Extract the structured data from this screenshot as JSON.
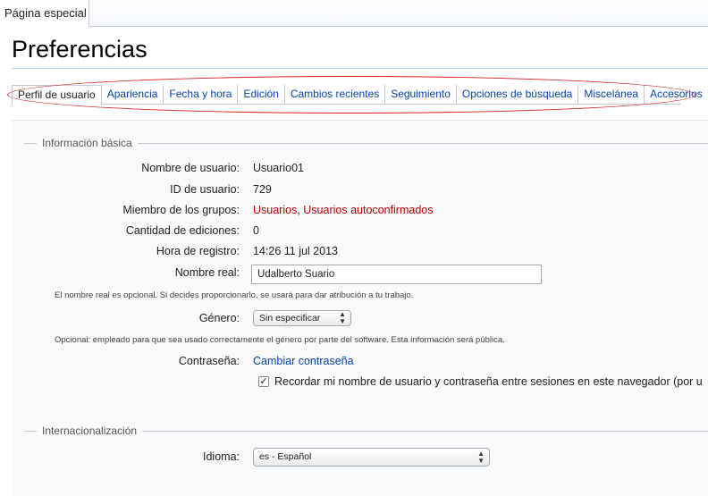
{
  "page_tab": {
    "label": "Página especial"
  },
  "title": "Preferencias",
  "tabs": [
    {
      "label": "Perfil de usuario",
      "active": true
    },
    {
      "label": "Apariencia"
    },
    {
      "label": "Fecha y hora"
    },
    {
      "label": "Edición"
    },
    {
      "label": "Cambios recientes"
    },
    {
      "label": "Seguimiento"
    },
    {
      "label": "Opciones de búsqueda"
    },
    {
      "label": "Miscelánea"
    },
    {
      "label": "Accesorios"
    }
  ],
  "basic": {
    "legend": "Información básica",
    "username_label": "Nombre de usuario:",
    "username": "Usuario01",
    "userid_label": "ID de usuario:",
    "userid": "729",
    "groups_label": "Miembro de los grupos:",
    "group1": "Usuarios",
    "group_sep": ", ",
    "group2": "Usuarios autoconfirmados",
    "edits_label": "Cantidad de ediciones:",
    "edits": "0",
    "registration_label": "Hora de registro:",
    "registration": "14:26 11 jul 2013",
    "realname_label": "Nombre real:",
    "realname": "Udalberto Suario",
    "realname_help": "El nombre real es opcional. Si decides proporcionarlo, se usará para dar atribución a tu trabajo.",
    "gender_label": "Género:",
    "gender": "Sin especificar",
    "gender_help": "Opcional: empleado para que sea usado correctamente el género por parte del software. Esta información será pública.",
    "password_label": "Contraseña:",
    "password_link": "Cambiar contraseña",
    "remember_label": "Recordar mi nombre de usuario y contraseña entre sesiones en este navegador (por u",
    "remember_checked": true
  },
  "i18n": {
    "legend": "Internacionalización",
    "language_label": "Idioma:",
    "language": "es - Español"
  },
  "colors": {
    "redlink": "#ba0000",
    "link": "#0645ad",
    "annotation": "#d62020"
  }
}
